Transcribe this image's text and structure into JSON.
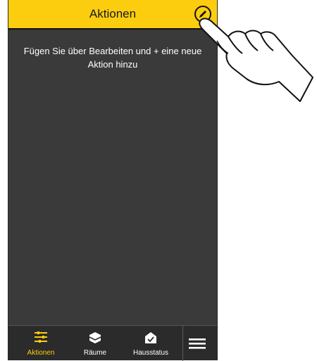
{
  "header": {
    "title": "Aktionen",
    "edit_icon": "pencil-icon"
  },
  "main": {
    "hint": "Fügen Sie über Bearbeiten und + eine neue Aktion hinzu"
  },
  "tabbar": {
    "items": [
      {
        "label": "Aktionen",
        "icon": "actions-list-icon",
        "active": true
      },
      {
        "label": "Räume",
        "icon": "room-cube-icon",
        "active": false
      },
      {
        "label": "Hausstatus",
        "icon": "house-check-icon",
        "active": false
      }
    ],
    "menu_icon": "hamburger-menu-icon"
  },
  "overlay": {
    "icon": "pointing-hand-icon"
  },
  "colors": {
    "accent": "#fccd0f",
    "background": "#3a3a3a",
    "tabbar": "#2b2b2b",
    "text": "#ffffff"
  }
}
